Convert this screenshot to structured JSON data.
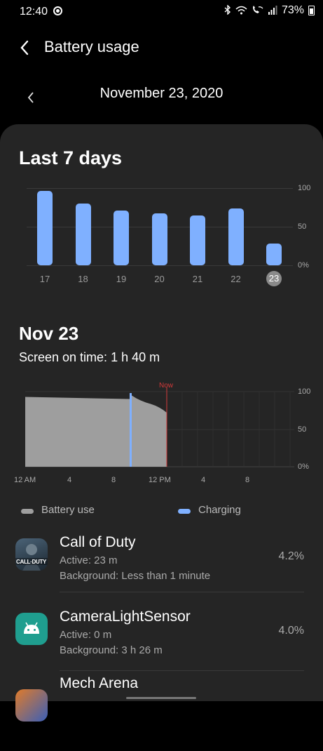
{
  "status_bar": {
    "time": "12:40",
    "battery_percent": "73%",
    "icons": [
      "bluetooth-icon",
      "wifi-icon",
      "wifi-call-icon",
      "signal-icon",
      "battery-icon"
    ]
  },
  "header": {
    "title": "Battery usage"
  },
  "date_nav": {
    "date": "November 23, 2020"
  },
  "weekly": {
    "title": "Last 7 days",
    "y_labels": [
      "100",
      "50",
      "0%"
    ]
  },
  "chart_data": {
    "type": "bar",
    "categories": [
      "17",
      "18",
      "19",
      "20",
      "21",
      "22",
      "23"
    ],
    "values": [
      96,
      80,
      71,
      67,
      65,
      74,
      28
    ],
    "ylim": [
      0,
      100
    ],
    "selected": "23"
  },
  "daily": {
    "title": "Nov 23",
    "screen_time": "Screen on time: 1 h 40 m",
    "now_label": "Now",
    "y_labels": [
      "100",
      "50",
      "0%"
    ],
    "x_labels": [
      "12 AM",
      "4",
      "8",
      "12 PM",
      "4",
      "8"
    ],
    "battery_level_start": 93,
    "battery_level_end": 72
  },
  "legend": {
    "battery_use": "Battery use",
    "charging": "Charging",
    "battery_use_color": "#9e9e9e",
    "charging_color": "#7fb0ff"
  },
  "apps": [
    {
      "name": "Call of Duty",
      "active": "Active: 23 m",
      "background": "Background: Less than 1 minute",
      "percent": "4.2%",
      "icon_text": "CALL·DUTY"
    },
    {
      "name": "CameraLightSensor",
      "active": "Active: 0 m",
      "background": "Background: 3 h 26 m",
      "percent": "4.0%"
    },
    {
      "name": "Mech Arena",
      "active": "",
      "background": "",
      "percent": ""
    }
  ]
}
